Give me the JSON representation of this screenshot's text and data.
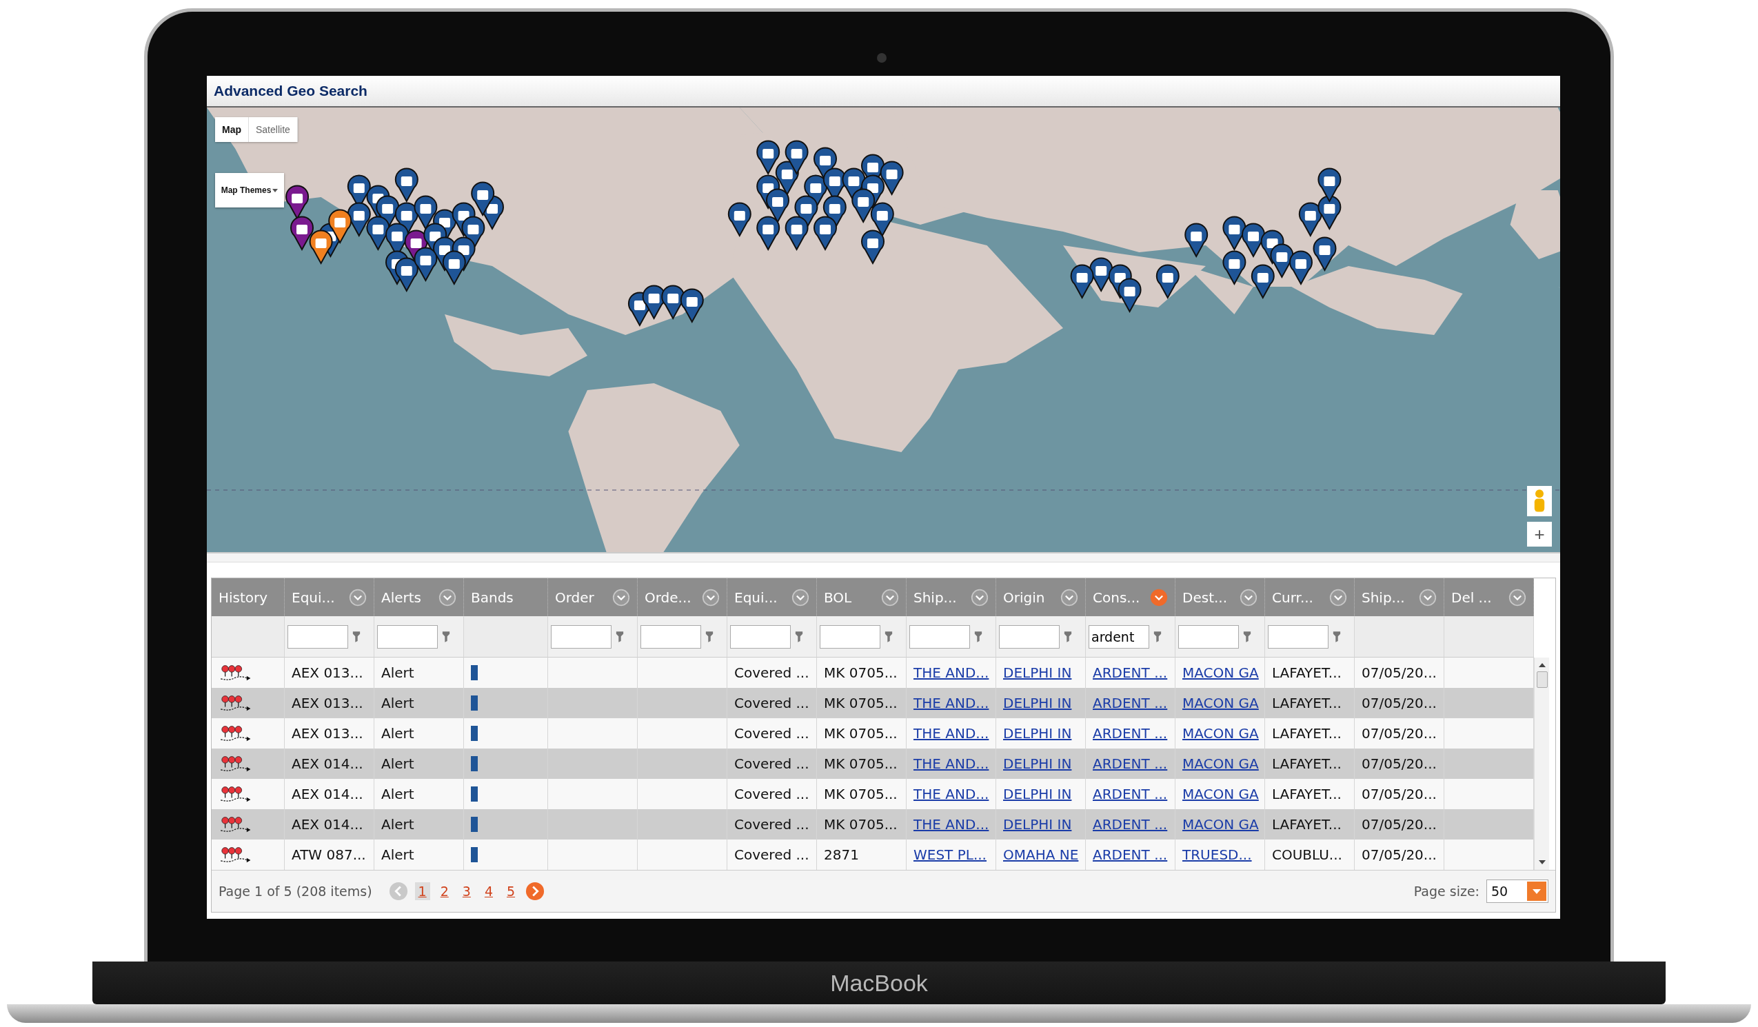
{
  "laptop": {
    "brand": "MacBook"
  },
  "window": {
    "title": "Advanced Geo Search"
  },
  "map": {
    "types": [
      {
        "label": "Map",
        "selected": true
      },
      {
        "label": "Satellite",
        "selected": false
      }
    ],
    "themes": "Map Themes",
    "zoom_in": "+"
  },
  "grid": {
    "columns": [
      {
        "label": "History",
        "kind": "history",
        "menu": false,
        "has_filter": false
      },
      {
        "label": "Equi...",
        "kind": "text",
        "menu": true,
        "filtered": false,
        "has_filter": true
      },
      {
        "label": "Alerts",
        "kind": "text",
        "menu": true,
        "filtered": false,
        "has_filter": true
      },
      {
        "label": "Bands",
        "kind": "band",
        "menu": false,
        "has_filter": false
      },
      {
        "label": "Order",
        "kind": "text",
        "menu": true,
        "filtered": false,
        "has_filter": true
      },
      {
        "label": "Orde...",
        "kind": "text",
        "menu": true,
        "filtered": false,
        "has_filter": true
      },
      {
        "label": "Equi...",
        "kind": "text",
        "menu": true,
        "filtered": false,
        "has_filter": true
      },
      {
        "label": "BOL",
        "kind": "text",
        "menu": true,
        "filtered": false,
        "has_filter": true
      },
      {
        "label": "Ship...",
        "kind": "link",
        "menu": true,
        "filtered": false,
        "has_filter": true
      },
      {
        "label": "Origin",
        "kind": "link",
        "menu": true,
        "filtered": false,
        "has_filter": true
      },
      {
        "label": "Cons...",
        "kind": "link",
        "menu": true,
        "filtered": true,
        "has_filter": true,
        "filter_value": "ardent"
      },
      {
        "label": "Dest...",
        "kind": "link",
        "menu": true,
        "filtered": false,
        "has_filter": true
      },
      {
        "label": "Curr...",
        "kind": "text",
        "menu": true,
        "filtered": false,
        "has_filter": true
      },
      {
        "label": "Ship...",
        "kind": "text",
        "menu": true,
        "filtered": false,
        "has_filter": false
      },
      {
        "label": "Del ...",
        "kind": "text",
        "menu": true,
        "filtered": false,
        "has_filter": false
      }
    ],
    "rows": [
      {
        "cells": [
          null,
          "AEX 013...",
          "Alert",
          null,
          null,
          null,
          "Covered ...",
          "MK 0705...",
          "THE AND...",
          "DELPHI IN",
          "ARDENT ...",
          "MACON GA",
          "LAFAYET...",
          "07/05/20...",
          null
        ]
      },
      {
        "cells": [
          null,
          "AEX 013...",
          "Alert",
          null,
          null,
          null,
          "Covered ...",
          "MK 0705...",
          "THE AND...",
          "DELPHI IN",
          "ARDENT ...",
          "MACON GA",
          "LAFAYET...",
          "07/05/20...",
          null
        ]
      },
      {
        "cells": [
          null,
          "AEX 013...",
          "Alert",
          null,
          null,
          null,
          "Covered ...",
          "MK 0705...",
          "THE AND...",
          "DELPHI IN",
          "ARDENT ...",
          "MACON GA",
          "LAFAYET...",
          "07/05/20...",
          null
        ]
      },
      {
        "cells": [
          null,
          "AEX 014...",
          "Alert",
          null,
          null,
          null,
          "Covered ...",
          "MK 0705...",
          "THE AND...",
          "DELPHI IN",
          "ARDENT ...",
          "MACON GA",
          "LAFAYET...",
          "07/05/20...",
          null
        ]
      },
      {
        "cells": [
          null,
          "AEX 014...",
          "Alert",
          null,
          null,
          null,
          "Covered ...",
          "MK 0705...",
          "THE AND...",
          "DELPHI IN",
          "ARDENT ...",
          "MACON GA",
          "LAFAYET...",
          "07/05/20...",
          null
        ]
      },
      {
        "cells": [
          null,
          "AEX 014...",
          "Alert",
          null,
          null,
          null,
          "Covered ...",
          "MK 0705...",
          "THE AND...",
          "DELPHI IN",
          "ARDENT ...",
          "MACON GA",
          "LAFAYET...",
          "07/05/20...",
          null
        ]
      },
      {
        "cells": [
          null,
          "ATW 087...",
          "Alert",
          null,
          null,
          null,
          "Covered ...",
          "2871",
          "WEST PL...",
          "OMAHA NE",
          "ARDENT ...",
          "TRUESD...",
          "COUBLU...",
          "07/05/20...",
          null
        ]
      }
    ]
  },
  "pager": {
    "summary": "Page 1 of 5 (208 items)",
    "pages": [
      {
        "label": "1",
        "selected": true
      },
      {
        "label": "2",
        "selected": false
      },
      {
        "label": "3",
        "selected": false
      },
      {
        "label": "4",
        "selected": false
      },
      {
        "label": "5",
        "selected": false
      }
    ],
    "size_label": "Page size:",
    "size": "50"
  }
}
